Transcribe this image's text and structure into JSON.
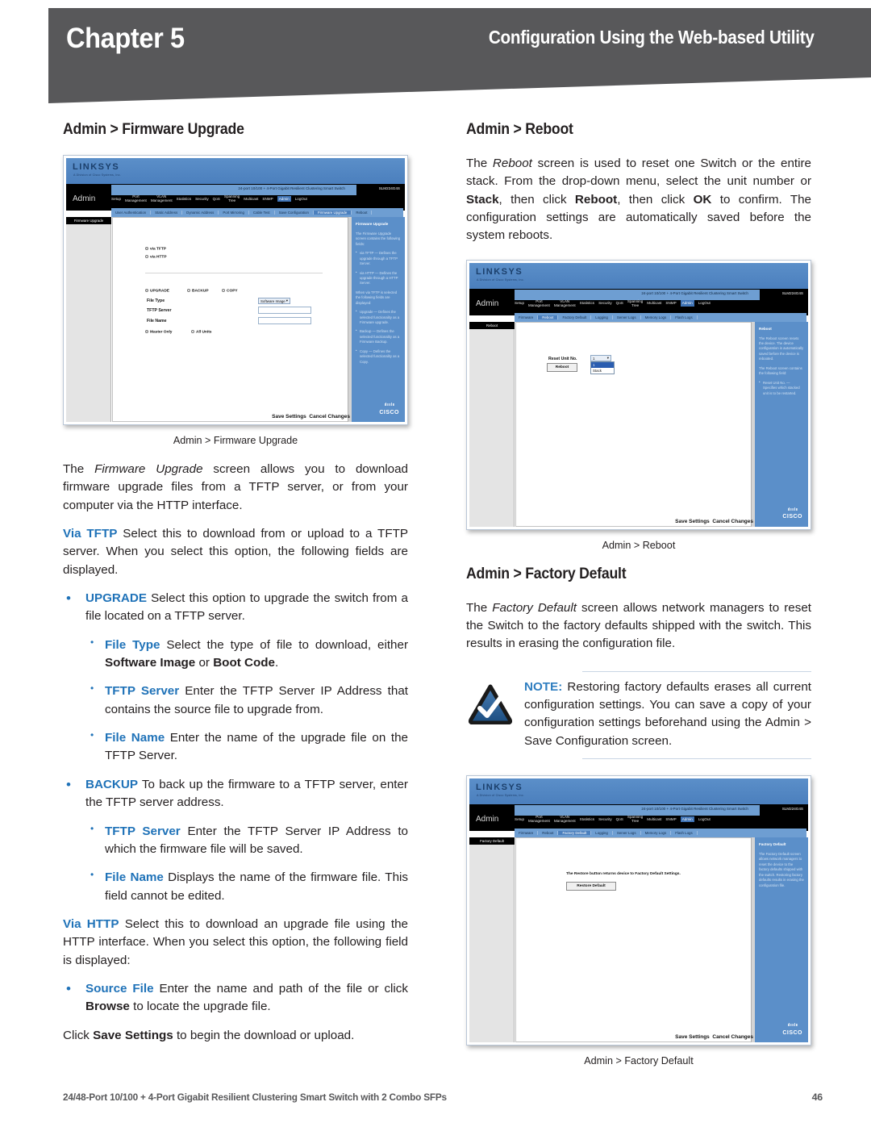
{
  "header": {
    "chapter": "Chapter 5",
    "subtitle": "Configuration Using the Web-based Utility",
    "band_color": "#58585a"
  },
  "accent_color": "#1f72b8",
  "left_column": {
    "heading": "Admin > Firmware Upgrade",
    "figure_caption": "Admin > Firmware Upgrade",
    "paragraph_1": {
      "lead": "The ",
      "italic": "Firmware Upgrade",
      "rest": " screen allows you to download firmware upgrade files from a TFTP server, or from your computer via the HTTP interface."
    },
    "via_tftp": {
      "term": "Via TFTP",
      "text": " Select this to download from or upload to a TFTP server. When you select this option, the following fields are displayed."
    },
    "bullets": [
      {
        "term": "UPGRADE",
        "text": " Select this option to upgrade the switch from a file located on a TFTP server.",
        "sub": [
          {
            "term": "File Type",
            "pre": " Select the type of file to download, either ",
            "b1": "Software Image",
            "mid": " or ",
            "b2": "Boot Code",
            "post": "."
          },
          {
            "term": "TFTP Server",
            "pre": " Enter the TFTP Server IP Address that contains the source file to upgrade from.",
            "b1": "",
            "mid": "",
            "b2": "",
            "post": ""
          },
          {
            "term": "File Name",
            "pre": " Enter the name of the upgrade file on the TFTP Server.",
            "b1": "",
            "mid": "",
            "b2": "",
            "post": ""
          }
        ]
      },
      {
        "term": "BACKUP",
        "text": " To back up the firmware to a TFTP server, enter the TFTP server address.",
        "sub": [
          {
            "term": "TFTP Server",
            "pre": " Enter the TFTP Server IP Address to which the firmware file will be saved.",
            "b1": "",
            "mid": "",
            "b2": "",
            "post": ""
          },
          {
            "term": "File Name",
            "pre": " Displays the name of the firmware file. This field cannot be edited.",
            "b1": "",
            "mid": "",
            "b2": "",
            "post": ""
          }
        ]
      }
    ],
    "via_http": {
      "term": "Via HTTP",
      "text": " Select this to download an upgrade file using the HTTP interface. When you select this option, the following field is displayed:"
    },
    "source_file_bullet": {
      "term": "Source File",
      "pre": " Enter the name and path of the file or click ",
      "bold": "Browse",
      "post": " to locate the upgrade file."
    },
    "closing": {
      "pre": "Click ",
      "bold": "Save Settings",
      "post": " to begin the download or upload."
    }
  },
  "right_column": {
    "reboot": {
      "heading": "Admin > Reboot",
      "figure_caption": "Admin > Reboot",
      "paragraph": {
        "p1": "The ",
        "i1": "Reboot",
        "p2": " screen is used to reset one Switch or the entire stack. From the drop-down menu, select the unit number or ",
        "b1": "Stack",
        "p3": ", then click ",
        "b2": "Reboot",
        "p4": ", then click ",
        "b3": "OK",
        "p5": " to confirm. The configuration settings are automatically saved before the system reboots."
      }
    },
    "factory_default": {
      "heading": "Admin > Factory Default",
      "figure_caption": "Admin > Factory Default",
      "paragraph": {
        "p1": "The ",
        "i1": "Factory Default",
        "p2": " screen allows network managers to reset the Switch to the factory defaults shipped with the switch. This results in erasing the configuration file."
      },
      "note": {
        "label": "NOTE:",
        "text": " Restoring factory defaults erases all current configuration settings. You can save a copy of your configuration settings beforehand using the Admin > Save Configuration screen."
      }
    }
  },
  "screenshots": {
    "common": {
      "brand": "LINKSYS",
      "brand_sub": "A Division of Cisco Systems, Inc.",
      "app_name": "Admin",
      "model_text": "24-port 10/100 + 4-Port Gigabit Resilient Clustering Smart Switch",
      "model_number": "SLM224G4S",
      "tabs": [
        "Setup",
        "Port\nManagement",
        "VLAN\nManagement",
        "Statistics",
        "Security",
        "QoS",
        "Spanning\nTree",
        "Multicast",
        "SNMP",
        "Admin",
        "LogOut"
      ],
      "active_tab": "Admin",
      "save_settings": "Save Settings",
      "cancel_changes": "Cancel Changes",
      "vendor": "CISCO"
    },
    "firmware_upgrade": {
      "subnav": [
        "User Authentication",
        "Static Address",
        "Dynamic Address",
        "Port Mirroring",
        "Cable Test",
        "Save Configuration",
        "Firmware Upgrade",
        "Reboot"
      ],
      "active_subnav": "Firmware Upgrade",
      "left_item": "Firmware Upgrade",
      "radio_via_tftp": "via TFTP",
      "radio_via_http": "via HTTP",
      "radio_upgrade": "UPGRADE",
      "radio_backup": "BACKUP",
      "radio_copy": "COPY",
      "label_file_type": "File Type",
      "label_tftp_server": "TFTP Server",
      "label_file_name": "File Name",
      "select_file_type": "Software Image",
      "radio_master_only": "Master Only",
      "radio_all_units": "All Units",
      "help_title": "Firmware Upgrade",
      "help_intro": "The Firmware Upgrade screen contains the following fields:",
      "help_items": [
        "via TFTP — Defines the upgrade through a TFTP Server.",
        "via HTTP — Defines the upgrade through a HTTP Server.",
        "Upgrade — Defines the selected functionality as a Firmware upgrade.",
        "Backup — Defines the selected functionality as a Firmware Backup.",
        "Copy — Defines the selected functionality as a Copy."
      ],
      "help_mid": "When via TFTP is selected the following fields are displayed:"
    },
    "reboot": {
      "subnav": [
        "Firmware",
        "Reboot",
        "Factory Default",
        "Logging",
        "Server Logs",
        "Memory Logs",
        "Flash Logs"
      ],
      "active_subnav": "Reboot",
      "left_item": "Reboot",
      "label_reset_unit": "Reset Unit No.",
      "dropdown_value": "1",
      "dropdown_options": [
        "1",
        "Stack"
      ],
      "button_reboot": "Reboot",
      "help_title": "Reboot",
      "help_p1": "The Reboot screen resets the device. The device configuration is automatically saved before the device is rebooted.",
      "help_p2": "The Reboot screen contains the following field:",
      "help_item": "Reset Unit No. — Specifies which stacked unit is to be restarted."
    },
    "factory_default": {
      "subnav": [
        "Firmware",
        "Reboot",
        "Factory Default",
        "Logging",
        "Server Logs",
        "Memory Logs",
        "Flash Logs"
      ],
      "active_subnav": "Factory Default",
      "left_item": "Factory Default",
      "notice": "The Restore button returns device to Factory Default Settings.",
      "button_restore": "Restore Default",
      "help_title": "Factory Default",
      "help_p1": "The Factory Default screen allows network managers to reset the device to the factory defaults shipped with the switch. Restoring factory defaults results in erasing the configuration file."
    }
  },
  "footer": {
    "product": "24/48-Port 10/100 + 4-Port Gigabit Resilient Clustering Smart Switch with 2 Combo SFPs",
    "page": "46"
  }
}
